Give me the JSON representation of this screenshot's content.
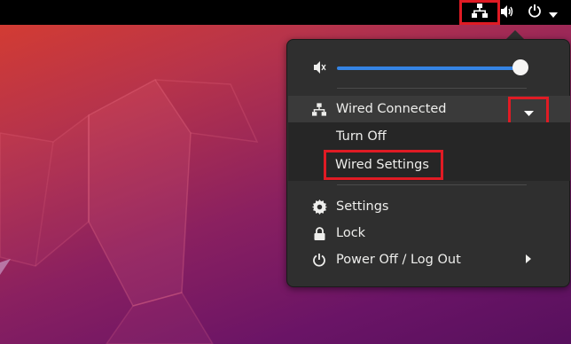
{
  "menu": {
    "network_label": "Wired Connected",
    "turn_off_label": "Turn Off",
    "wired_settings_label": "Wired Settings",
    "settings_label": "Settings",
    "lock_label": "Lock",
    "power_label": "Power Off / Log Out"
  },
  "volume": {
    "level": 0.96
  },
  "icons": {
    "network": "network-wired-icon",
    "volume_tray": "volume-high-icon",
    "power_tray": "power-icon",
    "menu_caret": "caret-down-icon",
    "volume_muted": "volume-muted-icon",
    "expand": "caret-down-icon",
    "gear": "gear-icon",
    "lock": "lock-icon",
    "power": "power-icon",
    "submenu": "chevron-right-icon"
  },
  "colors": {
    "topbar": "#000000",
    "menu_bg": "#2f2f2f",
    "accent": "#3584e4",
    "highlight": "#e01b24"
  }
}
